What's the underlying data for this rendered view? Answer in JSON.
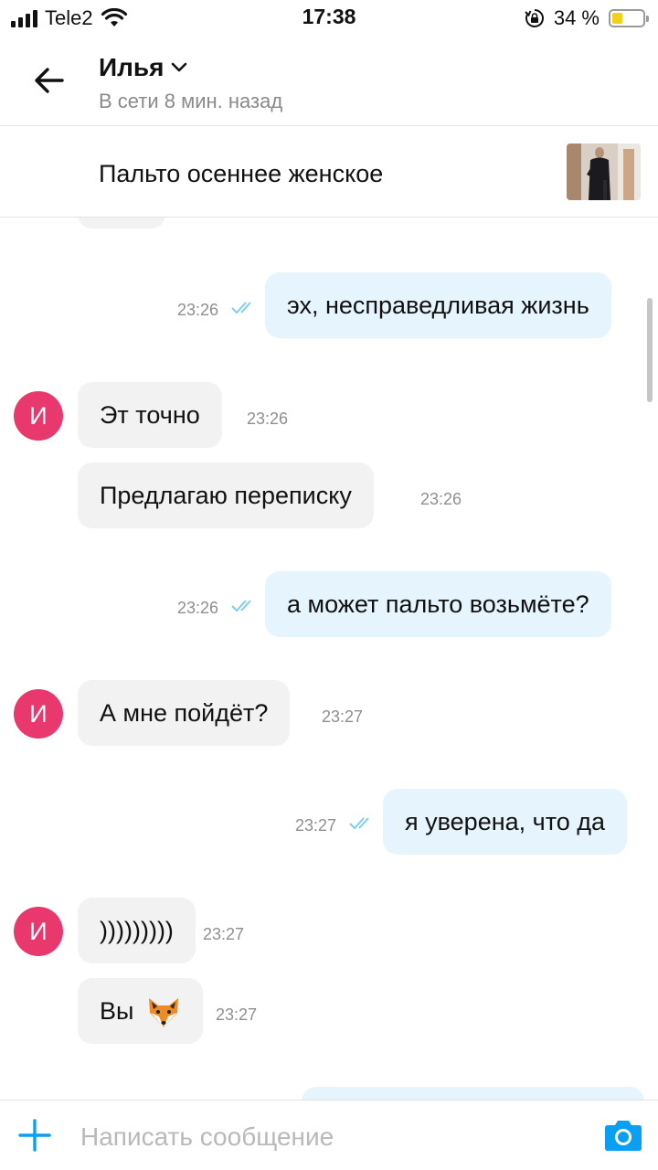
{
  "status_bar": {
    "carrier": "Tele2",
    "time": "17:38",
    "battery_percent": "34 %",
    "battery_level": 0.34,
    "icons": [
      "signal-icon",
      "wifi-icon",
      "orientation-lock-icon",
      "battery-icon"
    ]
  },
  "header": {
    "contact_name": "Илья",
    "status": "В сети 8 мин. назад",
    "icons": [
      "back-arrow-icon",
      "chevron-down-icon"
    ]
  },
  "product": {
    "title": "Пальто осеннее женское"
  },
  "messages": [
    {
      "direction": "out",
      "text": "эх, несправедливая жизнь",
      "time": "23:26",
      "read": true
    },
    {
      "direction": "in",
      "avatar": "И",
      "text": "Эт точно",
      "time": "23:26"
    },
    {
      "direction": "in",
      "text": "Предлагаю переписку",
      "time": "23:26"
    },
    {
      "direction": "out",
      "text": "а может пальто возьмёте?",
      "time": "23:26",
      "read": true
    },
    {
      "direction": "in",
      "avatar": "И",
      "text": "А мне пойдёт?",
      "time": "23:27"
    },
    {
      "direction": "out",
      "text": "я уверена, что да",
      "time": "23:27",
      "read": true
    },
    {
      "direction": "in",
      "avatar": "И",
      "text": ")))))))))",
      "time": "23:27"
    },
    {
      "direction": "in",
      "text": "Вы",
      "emoji": "fox-face-icon",
      "time": "23:27"
    }
  ],
  "composer": {
    "placeholder": "Написать сообщение",
    "value": "",
    "icons": [
      "plus-icon",
      "camera-icon"
    ]
  },
  "colors": {
    "accent": "#0a9ff0",
    "incoming_bubble": "#f2f2f2",
    "outgoing_bubble": "#e6f5fd",
    "avatar": "#e8386d",
    "read_ticks": "#7fcdf3"
  }
}
